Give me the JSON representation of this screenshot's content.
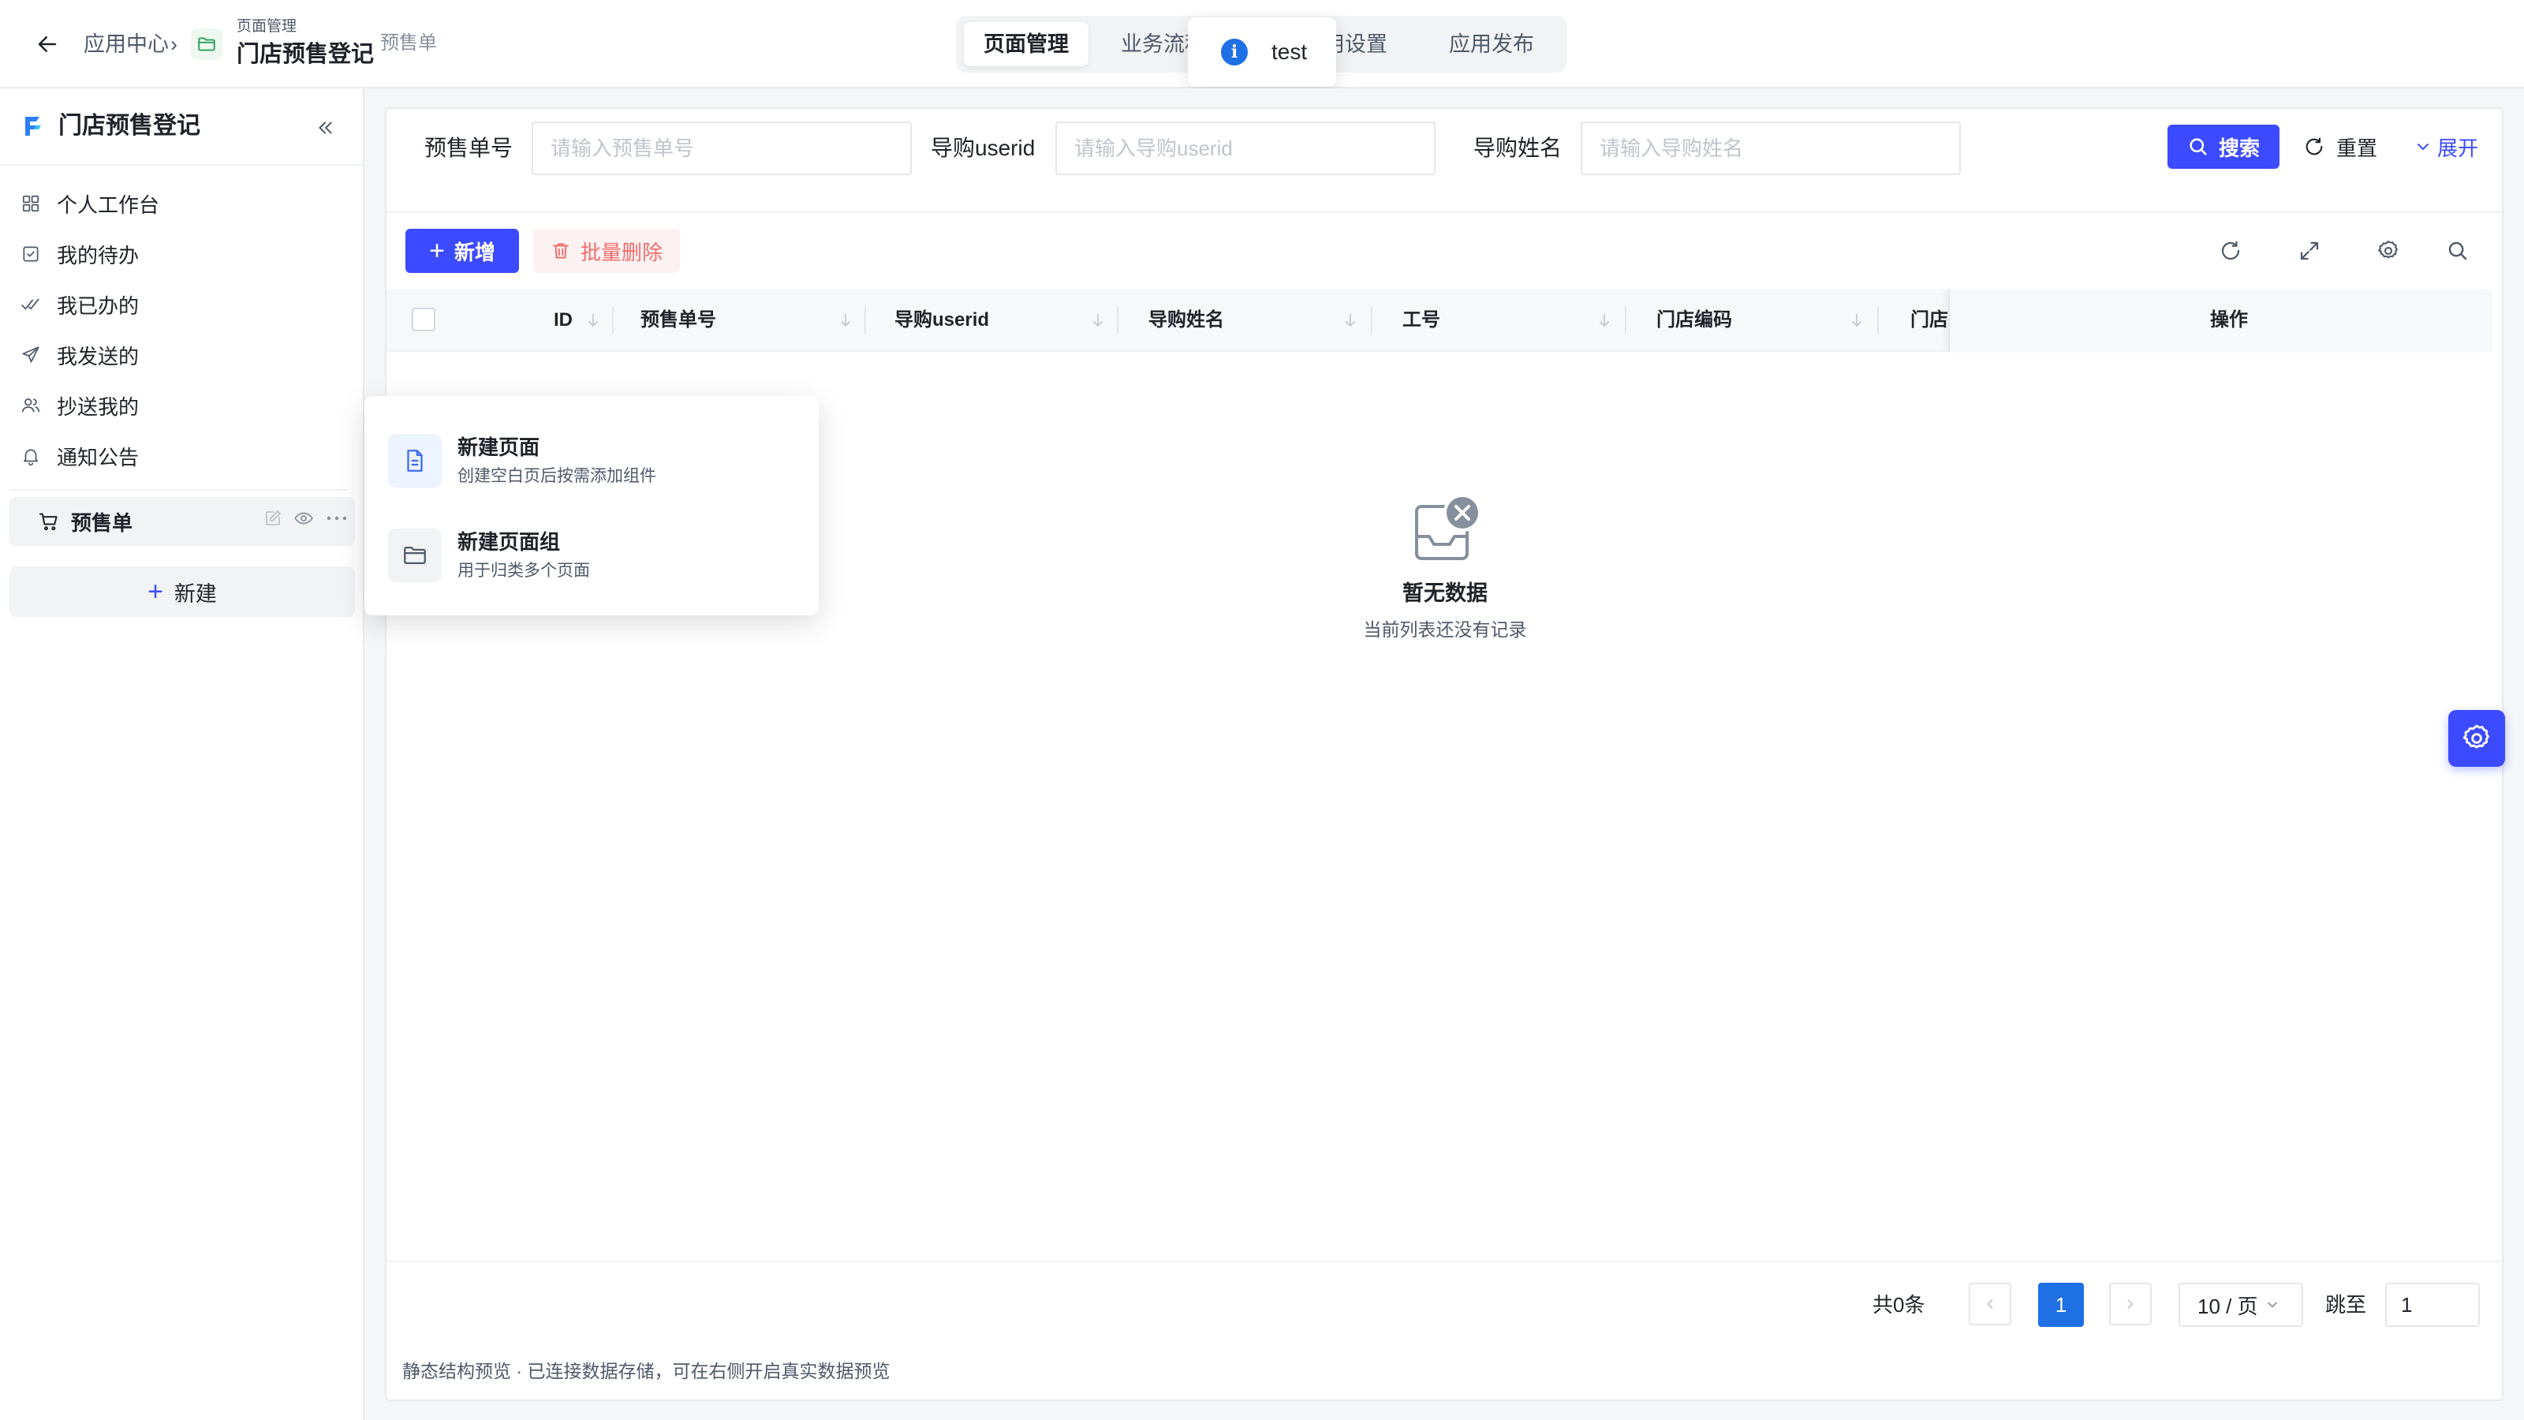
{
  "header": {
    "breadcrumb_root": "应用中心",
    "breadcrumb_sep": "›",
    "group_label": "页面管理",
    "app_title": "门店预售登记",
    "page_name": "预售单",
    "tabs": [
      {
        "label": "页面管理",
        "active": true
      },
      {
        "label": "业务流程",
        "active": false
      },
      {
        "label": "应用设置",
        "active": false
      },
      {
        "label": "应用发布",
        "active": false
      }
    ]
  },
  "toast": {
    "icon": "info-icon",
    "text": "test"
  },
  "sidebar": {
    "title": "门店预售登记",
    "items": [
      {
        "label": "个人工作台",
        "icon": "grid-icon"
      },
      {
        "label": "我的待办",
        "icon": "checkbox-icon"
      },
      {
        "label": "我已办的",
        "icon": "double-check-icon"
      },
      {
        "label": "我发送的",
        "icon": "send-icon"
      },
      {
        "label": "抄送我的",
        "icon": "users-icon"
      },
      {
        "label": "通知公告",
        "icon": "bell-icon"
      }
    ],
    "page_item": {
      "label": "预售单",
      "icon": "cart-icon"
    },
    "new_button": "新建"
  },
  "dropdown": {
    "items": [
      {
        "title": "新建页面",
        "desc": "创建空白页后按需添加组件",
        "icon": "document-icon"
      },
      {
        "title": "新建页面组",
        "desc": "用于归类多个页面",
        "icon": "folder-icon"
      }
    ]
  },
  "filters": [
    {
      "label": "预售单号",
      "placeholder": "请输入预售单号"
    },
    {
      "label": "导购userid",
      "placeholder": "请输入导购userid"
    },
    {
      "label": "导购姓名",
      "placeholder": "请输入导购姓名"
    }
  ],
  "filter_actions": {
    "search": "搜索",
    "reset": "重置",
    "expand": "展开"
  },
  "toolbar": {
    "add": "新增",
    "batch_delete": "批量删除"
  },
  "table": {
    "columns": [
      "ID",
      "预售单号",
      "导购userid",
      "导购姓名",
      "工号",
      "门店编码",
      "门店"
    ],
    "action_column": "操作"
  },
  "empty": {
    "title": "暂无数据",
    "desc": "当前列表还没有记录"
  },
  "pagination": {
    "total": "共0条",
    "current_page": "1",
    "page_size": "10 / 页",
    "jump_label": "跳至",
    "jump_value": "1"
  },
  "footer_note": "静态结构预览 · 已连接数据存储，可在右侧开启真实数据预览",
  "colors": {
    "primary": "#3c4bff",
    "info": "#1f6fe5",
    "danger": "#f26d6d"
  }
}
